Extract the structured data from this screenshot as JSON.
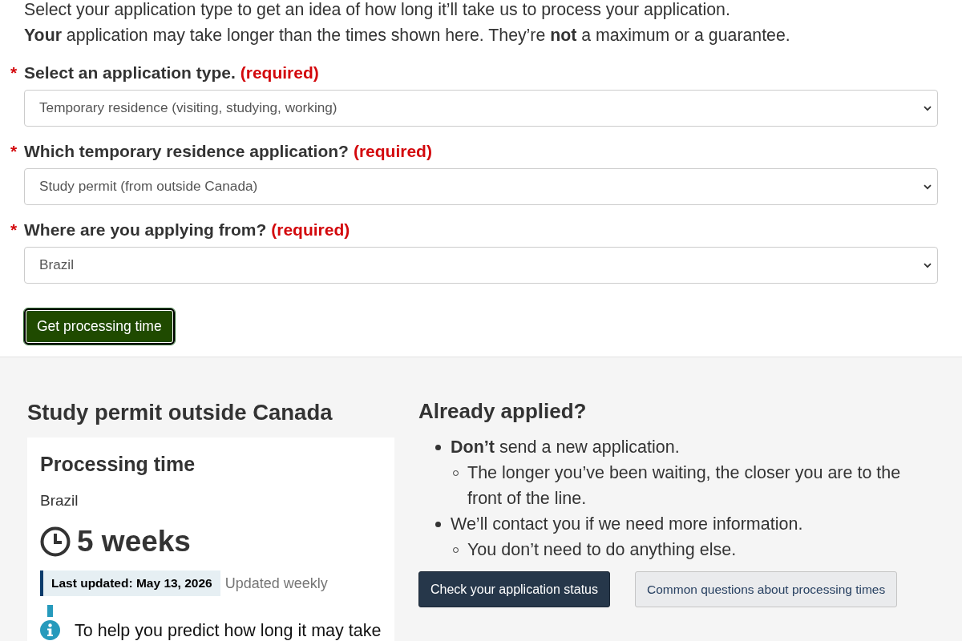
{
  "intro": "Select your application type to get an idea of how long it’ll take us to process your application.",
  "notice": "**Your** application may take longer than the times shown here. They’re **not** a maximum or a guarantee.",
  "form": {
    "fields": [
      {
        "marker": "*",
        "label": "Select an application type.",
        "required": "(required)",
        "value": "Temporary residence (visiting, studying, working)"
      },
      {
        "marker": "*",
        "label": "Which temporary residence application?",
        "required": "(required)",
        "value": "Study permit (from outside Canada)"
      },
      {
        "marker": "*",
        "label": "Where are you applying from?",
        "required": "(required)",
        "value": "Brazil"
      }
    ],
    "submit_button": "Get processing time"
  },
  "result": {
    "title": "Study permit outside Canada",
    "card": {
      "heading": "Processing time",
      "location": "Brazil",
      "duration": "5 weeks",
      "last_updated": "Last updated: May 13, 2026",
      "frequency": "Updated weekly",
      "info_text": "To help you predict how long it may take"
    }
  },
  "already_applied": {
    "title": "Already applied?",
    "items": [
      {
        "text": "**Don’t** send a new application.",
        "children": [
          {
            "text": "The longer you’ve been waiting, the closer you are to the front of the line."
          }
        ]
      },
      {
        "text": "We’ll contact you if we need more information.",
        "children": [
          {
            "text": "You don’t need to do anything else."
          }
        ]
      }
    ],
    "buttons": [
      {
        "label": "Check your application status",
        "kind": "primary"
      },
      {
        "label": "Common questions about processing times",
        "kind": "secondary"
      }
    ]
  }
}
